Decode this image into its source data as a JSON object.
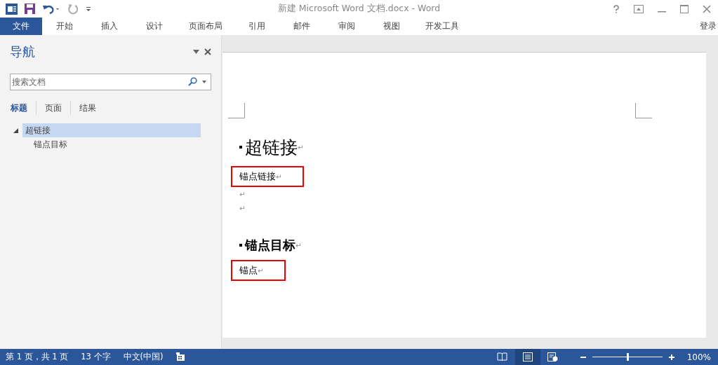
{
  "window": {
    "title": "新建 Microsoft Word 文档.docx - Word"
  },
  "ribbon_tabs": [
    {
      "label": "文件",
      "selected": true
    },
    {
      "label": "开始",
      "selected": false
    },
    {
      "label": "插入",
      "selected": false
    },
    {
      "label": "设计",
      "selected": false
    },
    {
      "label": "页面布局",
      "selected": false
    },
    {
      "label": "引用",
      "selected": false
    },
    {
      "label": "邮件",
      "selected": false
    },
    {
      "label": "审阅",
      "selected": false
    },
    {
      "label": "视图",
      "selected": false
    },
    {
      "label": "开发工具",
      "selected": false
    }
  ],
  "sign_in": "登录",
  "navigation": {
    "title": "导航",
    "search": {
      "placeholder": "搜索文档"
    },
    "tabs": [
      {
        "label": "标题",
        "selected": true
      },
      {
        "label": "页面",
        "selected": false
      },
      {
        "label": "结果",
        "selected": false
      }
    ],
    "tree": [
      {
        "label": "超链接",
        "selected": true,
        "expanded": true,
        "children": [
          {
            "label": "锚点目标",
            "selected": false
          }
        ]
      }
    ]
  },
  "document": {
    "blocks": [
      {
        "kind": "heading1",
        "text": "超链接",
        "mark": "↵"
      },
      {
        "kind": "boxed",
        "text": "锚点链接",
        "mark": "↵"
      },
      {
        "kind": "empty",
        "mark": "↵"
      },
      {
        "kind": "empty",
        "mark": "↵"
      },
      {
        "kind": "heading2",
        "text": "锚点目标",
        "mark": "↵"
      },
      {
        "kind": "boxed",
        "text": "锚点",
        "mark": "↵"
      }
    ]
  },
  "status_bar": {
    "page": "第 1 页，共 1 页",
    "words": "13 个字",
    "language": "中文(中国)",
    "zoom": {
      "level": 0.5,
      "reading": "100%"
    }
  }
}
